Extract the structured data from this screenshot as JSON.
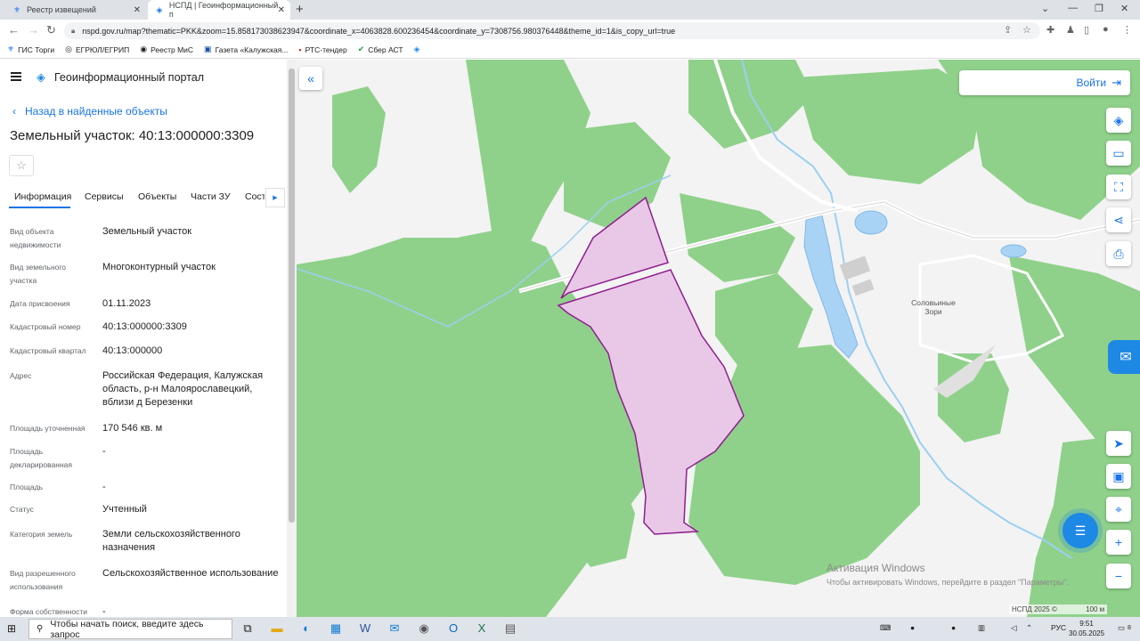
{
  "browser": {
    "tabs": [
      {
        "label": "Реестр извещений",
        "icon": "eagle-icon"
      },
      {
        "label": "НСПД | Геоинформационный п",
        "icon": "nspd-icon"
      }
    ],
    "new_tab": "+",
    "url": "nspd.gov.ru/map?thematic=PKK&zoom=15.858173038623947&coordinate_x=4063828.600236454&coordinate_y=7308756.980376448&theme_id=1&is_copy_url=true",
    "bookmarks": [
      {
        "label": "ГИС Торги",
        "icon": "eagle-icon"
      },
      {
        "label": "ЕГРЮЛ/ЕГРИП",
        "icon": "fns-icon"
      },
      {
        "label": "Реестр МиС",
        "icon": "registry-icon"
      },
      {
        "label": "Газета «Калужская...",
        "icon": "newspaper-icon"
      },
      {
        "label": "РТС-тендер",
        "icon": "rts-icon"
      },
      {
        "label": "Сбер АСТ",
        "icon": "sber-icon"
      }
    ]
  },
  "sidebar": {
    "portal_title": "Геоинформационный портал",
    "back_label": "Назад в найденные объекты",
    "object_title": "Земельный участок: 40:13:000000:3309",
    "tabs": [
      "Информация",
      "Сервисы",
      "Объекты",
      "Части ЗУ",
      "Соста"
    ],
    "fields": [
      {
        "label": "Вид объекта недвижимости",
        "value": "Земельный участок"
      },
      {
        "label": "Вид земельного участка",
        "value": "Многоконтурный участок"
      },
      {
        "label": "Дата присвоения",
        "value": "01.11.2023"
      },
      {
        "label": "Кадастровый номер",
        "value": "40:13:000000:3309"
      },
      {
        "label": "Кадастровый квартал",
        "value": "40:13:000000"
      },
      {
        "label": "Адрес",
        "value": "Российская Федерация, Калужская область, р-н Малоярославецкий, вблизи д Березенки"
      },
      {
        "label": "Площадь уточненная",
        "value": "170 546 кв. м"
      },
      {
        "label": "Площадь декларированная",
        "value": "-"
      },
      {
        "label": "Площадь",
        "value": "-"
      },
      {
        "label": "Статус",
        "value": "Учтенный"
      },
      {
        "label": "Категория земель",
        "value": "Земли сельскохозяйственного назначения"
      },
      {
        "label": "Вид разрешенного использования",
        "value": "Сельскохозяйственное использование"
      },
      {
        "label": "Форма собственности",
        "value": "-"
      }
    ]
  },
  "map": {
    "login_label": "Войти",
    "village_label": "Соловьиные Зори",
    "activation_title": "Активация Windows",
    "activation_text": "Чтобы активировать Windows, перейдите в раздел \"Параметры\".",
    "scale_label": "НСПД 2025 ©",
    "scale_value": "100 м",
    "colors": {
      "forest": "#8fd18a",
      "parcel_fill": "#e8c8e6",
      "parcel_stroke": "#8e1f8f",
      "water": "#a9d3f5"
    }
  },
  "taskbar": {
    "search_placeholder": "Чтобы начать поиск, введите здесь запрос",
    "lang": "РУС",
    "time": "9:51",
    "date": "30.05.2025",
    "notif_count": "8"
  }
}
